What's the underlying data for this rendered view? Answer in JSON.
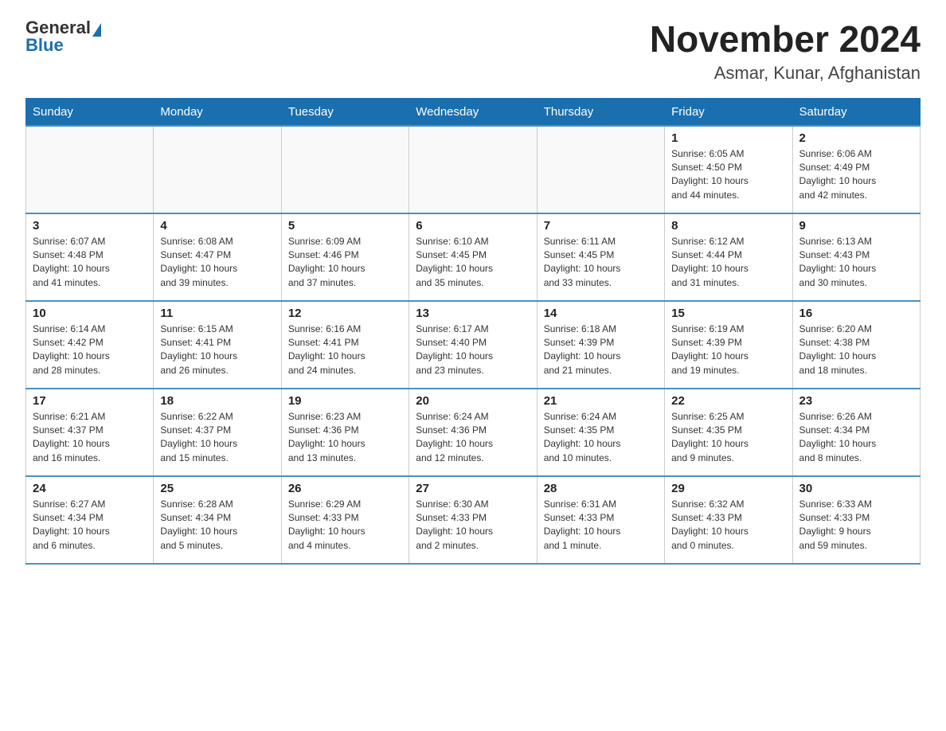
{
  "header": {
    "logo_general": "General",
    "logo_blue": "Blue",
    "month_title": "November 2024",
    "location": "Asmar, Kunar, Afghanistan"
  },
  "weekdays": [
    "Sunday",
    "Monday",
    "Tuesday",
    "Wednesday",
    "Thursday",
    "Friday",
    "Saturday"
  ],
  "weeks": [
    [
      {
        "day": "",
        "info": ""
      },
      {
        "day": "",
        "info": ""
      },
      {
        "day": "",
        "info": ""
      },
      {
        "day": "",
        "info": ""
      },
      {
        "day": "",
        "info": ""
      },
      {
        "day": "1",
        "info": "Sunrise: 6:05 AM\nSunset: 4:50 PM\nDaylight: 10 hours\nand 44 minutes."
      },
      {
        "day": "2",
        "info": "Sunrise: 6:06 AM\nSunset: 4:49 PM\nDaylight: 10 hours\nand 42 minutes."
      }
    ],
    [
      {
        "day": "3",
        "info": "Sunrise: 6:07 AM\nSunset: 4:48 PM\nDaylight: 10 hours\nand 41 minutes."
      },
      {
        "day": "4",
        "info": "Sunrise: 6:08 AM\nSunset: 4:47 PM\nDaylight: 10 hours\nand 39 minutes."
      },
      {
        "day": "5",
        "info": "Sunrise: 6:09 AM\nSunset: 4:46 PM\nDaylight: 10 hours\nand 37 minutes."
      },
      {
        "day": "6",
        "info": "Sunrise: 6:10 AM\nSunset: 4:45 PM\nDaylight: 10 hours\nand 35 minutes."
      },
      {
        "day": "7",
        "info": "Sunrise: 6:11 AM\nSunset: 4:45 PM\nDaylight: 10 hours\nand 33 minutes."
      },
      {
        "day": "8",
        "info": "Sunrise: 6:12 AM\nSunset: 4:44 PM\nDaylight: 10 hours\nand 31 minutes."
      },
      {
        "day": "9",
        "info": "Sunrise: 6:13 AM\nSunset: 4:43 PM\nDaylight: 10 hours\nand 30 minutes."
      }
    ],
    [
      {
        "day": "10",
        "info": "Sunrise: 6:14 AM\nSunset: 4:42 PM\nDaylight: 10 hours\nand 28 minutes."
      },
      {
        "day": "11",
        "info": "Sunrise: 6:15 AM\nSunset: 4:41 PM\nDaylight: 10 hours\nand 26 minutes."
      },
      {
        "day": "12",
        "info": "Sunrise: 6:16 AM\nSunset: 4:41 PM\nDaylight: 10 hours\nand 24 minutes."
      },
      {
        "day": "13",
        "info": "Sunrise: 6:17 AM\nSunset: 4:40 PM\nDaylight: 10 hours\nand 23 minutes."
      },
      {
        "day": "14",
        "info": "Sunrise: 6:18 AM\nSunset: 4:39 PM\nDaylight: 10 hours\nand 21 minutes."
      },
      {
        "day": "15",
        "info": "Sunrise: 6:19 AM\nSunset: 4:39 PM\nDaylight: 10 hours\nand 19 minutes."
      },
      {
        "day": "16",
        "info": "Sunrise: 6:20 AM\nSunset: 4:38 PM\nDaylight: 10 hours\nand 18 minutes."
      }
    ],
    [
      {
        "day": "17",
        "info": "Sunrise: 6:21 AM\nSunset: 4:37 PM\nDaylight: 10 hours\nand 16 minutes."
      },
      {
        "day": "18",
        "info": "Sunrise: 6:22 AM\nSunset: 4:37 PM\nDaylight: 10 hours\nand 15 minutes."
      },
      {
        "day": "19",
        "info": "Sunrise: 6:23 AM\nSunset: 4:36 PM\nDaylight: 10 hours\nand 13 minutes."
      },
      {
        "day": "20",
        "info": "Sunrise: 6:24 AM\nSunset: 4:36 PM\nDaylight: 10 hours\nand 12 minutes."
      },
      {
        "day": "21",
        "info": "Sunrise: 6:24 AM\nSunset: 4:35 PM\nDaylight: 10 hours\nand 10 minutes."
      },
      {
        "day": "22",
        "info": "Sunrise: 6:25 AM\nSunset: 4:35 PM\nDaylight: 10 hours\nand 9 minutes."
      },
      {
        "day": "23",
        "info": "Sunrise: 6:26 AM\nSunset: 4:34 PM\nDaylight: 10 hours\nand 8 minutes."
      }
    ],
    [
      {
        "day": "24",
        "info": "Sunrise: 6:27 AM\nSunset: 4:34 PM\nDaylight: 10 hours\nand 6 minutes."
      },
      {
        "day": "25",
        "info": "Sunrise: 6:28 AM\nSunset: 4:34 PM\nDaylight: 10 hours\nand 5 minutes."
      },
      {
        "day": "26",
        "info": "Sunrise: 6:29 AM\nSunset: 4:33 PM\nDaylight: 10 hours\nand 4 minutes."
      },
      {
        "day": "27",
        "info": "Sunrise: 6:30 AM\nSunset: 4:33 PM\nDaylight: 10 hours\nand 2 minutes."
      },
      {
        "day": "28",
        "info": "Sunrise: 6:31 AM\nSunset: 4:33 PM\nDaylight: 10 hours\nand 1 minute."
      },
      {
        "day": "29",
        "info": "Sunrise: 6:32 AM\nSunset: 4:33 PM\nDaylight: 10 hours\nand 0 minutes."
      },
      {
        "day": "30",
        "info": "Sunrise: 6:33 AM\nSunset: 4:33 PM\nDaylight: 9 hours\nand 59 minutes."
      }
    ]
  ]
}
